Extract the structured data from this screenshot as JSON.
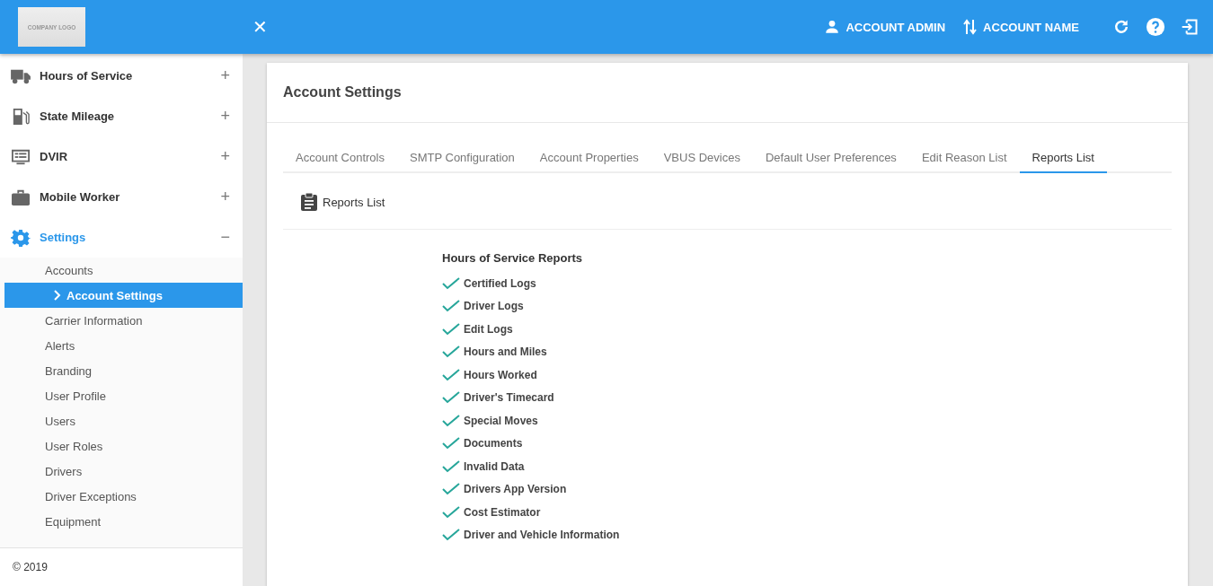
{
  "header": {
    "logo": "COMPANY LOGO",
    "close_icon": "✕",
    "user": "ACCOUNT ADMIN",
    "account": "ACCOUNT NAME"
  },
  "sidebar": {
    "groups": [
      {
        "label": "Hours of Service",
        "expanded": false,
        "toggle": "+"
      },
      {
        "label": "State Mileage",
        "expanded": false,
        "toggle": "+"
      },
      {
        "label": "DVIR",
        "expanded": false,
        "toggle": "+"
      },
      {
        "label": "Mobile Worker",
        "expanded": false,
        "toggle": "+"
      },
      {
        "label": "Settings",
        "expanded": true,
        "toggle": "−",
        "children": [
          {
            "label": "Accounts",
            "selected": false
          },
          {
            "label": "Account Settings",
            "selected": true
          },
          {
            "label": "Carrier Information",
            "selected": false
          },
          {
            "label": "Alerts",
            "selected": false
          },
          {
            "label": "Branding",
            "selected": false
          },
          {
            "label": "User Profile",
            "selected": false
          },
          {
            "label": "Users",
            "selected": false
          },
          {
            "label": "User Roles",
            "selected": false
          },
          {
            "label": "Drivers",
            "selected": false
          },
          {
            "label": "Driver Exceptions",
            "selected": false
          },
          {
            "label": "Equipment",
            "selected": false
          }
        ]
      }
    ],
    "footer": "© 2019"
  },
  "page": {
    "title": "Account Settings",
    "tabs": [
      {
        "label": "Account Controls",
        "selected": false
      },
      {
        "label": "SMTP Configuration",
        "selected": false
      },
      {
        "label": "Account Properties",
        "selected": false
      },
      {
        "label": "VBUS Devices",
        "selected": false
      },
      {
        "label": "Default User Preferences",
        "selected": false
      },
      {
        "label": "Edit Reason List",
        "selected": false
      },
      {
        "label": "Reports List",
        "selected": true
      }
    ],
    "section_title": "Reports List",
    "report_group": "Hours of Service Reports",
    "reports": [
      {
        "label": "Certified Logs",
        "checked": true
      },
      {
        "label": "Driver Logs",
        "checked": true
      },
      {
        "label": "Edit Logs",
        "checked": true
      },
      {
        "label": "Hours and Miles",
        "checked": true
      },
      {
        "label": "Hours Worked",
        "checked": true
      },
      {
        "label": "Driver's Timecard",
        "checked": true
      },
      {
        "label": "Special Moves",
        "checked": true
      },
      {
        "label": "Documents",
        "checked": true
      },
      {
        "label": "Invalid Data",
        "checked": true
      },
      {
        "label": "Drivers App Version",
        "checked": true
      },
      {
        "label": "Cost Estimator",
        "checked": true
      },
      {
        "label": "Driver and Vehicle Information",
        "checked": true
      }
    ]
  }
}
